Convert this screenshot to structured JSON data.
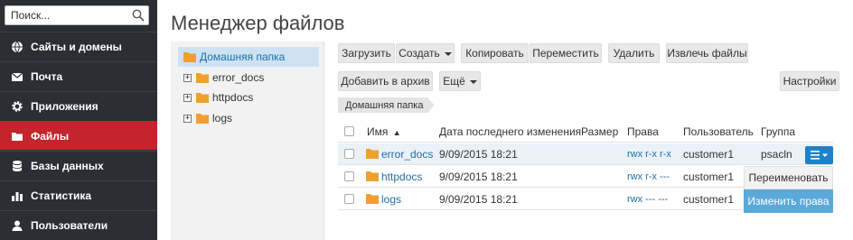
{
  "sidebar": {
    "search_placeholder": "Поиск...",
    "items": [
      {
        "label": "Сайты и домены",
        "icon": "globe-icon"
      },
      {
        "label": "Почта",
        "icon": "envelope-icon"
      },
      {
        "label": "Приложения",
        "icon": "gear-icon"
      },
      {
        "label": "Файлы",
        "icon": "folder-icon",
        "active": true
      },
      {
        "label": "Базы данных",
        "icon": "database-icon"
      },
      {
        "label": "Статистика",
        "icon": "bar-chart-icon"
      },
      {
        "label": "Пользователи",
        "icon": "user-icon"
      }
    ]
  },
  "page": {
    "title": "Менеджер файлов"
  },
  "tree": {
    "root": "Домашняя папка",
    "items": [
      "error_docs",
      "httpdocs",
      "logs"
    ]
  },
  "toolbar": {
    "upload": "Загрузить",
    "create": "Создать",
    "copy": "Копировать",
    "move": "Переместить",
    "delete": "Удалить",
    "extract": "Извлечь файлы",
    "archive": "Добавить в архив",
    "more": "Ещё",
    "settings": "Настройки"
  },
  "breadcrumb": "Домашняя папка",
  "table": {
    "headers": {
      "name": "Имя",
      "date": "Дата последнего изменения",
      "size": "Размер",
      "perms": "Права",
      "user": "Пользователь",
      "group": "Группа"
    },
    "rows": [
      {
        "name": "error_docs",
        "date": "9/09/2015 18:21",
        "perms": "rwx r-x r-x",
        "user": "customer1",
        "group": "psacln"
      },
      {
        "name": "httpdocs",
        "date": "9/09/2015 18:21",
        "perms": "rwx r-x ---",
        "user": "customer1",
        "group": ""
      },
      {
        "name": "logs",
        "date": "9/09/2015 18:21",
        "perms": "rwx --- ---",
        "user": "customer1",
        "group": ""
      }
    ]
  },
  "context_menu": {
    "rename": "Переименовать",
    "change_perms": "Изменить права"
  },
  "colors": {
    "sidebar_bg": "#2b2f33",
    "active_nav": "#c4242c",
    "link": "#1e6fa9",
    "folder": "#f0a030",
    "action_button": "#1f82c8",
    "menu_highlight": "#5aa9d9"
  }
}
